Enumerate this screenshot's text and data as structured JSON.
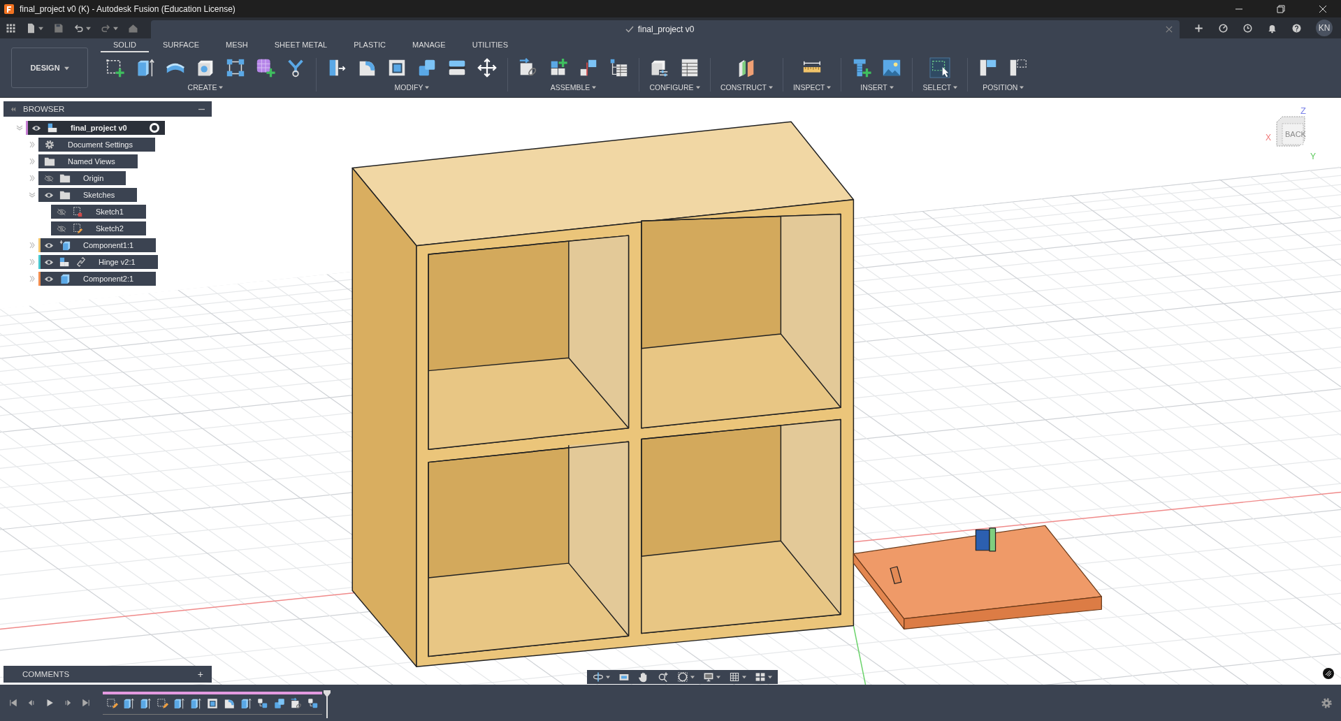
{
  "window": {
    "title": "final_project v0 (K) - Autodesk Fusion (Education License)"
  },
  "app_bar": {
    "left_tools": [
      {
        "kind": "apps",
        "menu": false
      },
      {
        "kind": "file",
        "menu": true
      },
      {
        "kind": "save",
        "menu": false
      },
      {
        "kind": "undo",
        "menu": true
      },
      {
        "kind": "redo",
        "menu": true
      },
      {
        "kind": "home",
        "menu": false
      }
    ],
    "document_tab": {
      "title": "final_project v0",
      "saved": true
    },
    "right_tools": [
      {
        "kind": "plus"
      },
      {
        "kind": "extensions"
      },
      {
        "kind": "jobs"
      },
      {
        "kind": "bell"
      },
      {
        "kind": "help"
      }
    ],
    "avatar": "KN"
  },
  "workspace": "DESIGN",
  "tabs": [
    {
      "label": "SOLID",
      "selected": true
    },
    {
      "label": "SURFACE",
      "selected": false
    },
    {
      "label": "MESH",
      "selected": false
    },
    {
      "label": "SHEET METAL",
      "selected": false
    },
    {
      "label": "PLASTIC",
      "selected": false
    },
    {
      "label": "MANAGE",
      "selected": false
    },
    {
      "label": "UTILITIES",
      "selected": false
    }
  ],
  "toolbar_groups": [
    {
      "label": "CREATE",
      "tools": [
        {
          "kind": "sketch"
        },
        {
          "kind": "extrude"
        },
        {
          "kind": "revolve"
        },
        {
          "kind": "hole"
        },
        {
          "kind": "pattern"
        },
        {
          "kind": "form"
        },
        {
          "kind": "derive"
        }
      ]
    },
    {
      "label": "MODIFY",
      "tools": [
        {
          "kind": "presspull"
        },
        {
          "kind": "fillet"
        },
        {
          "kind": "shell"
        },
        {
          "kind": "combine"
        },
        {
          "kind": "split"
        },
        {
          "kind": "move"
        }
      ]
    },
    {
      "label": "ASSEMBLE",
      "tools": [
        {
          "kind": "joint"
        },
        {
          "kind": "newcomp"
        },
        {
          "kind": "asbuilt"
        },
        {
          "kind": "bom"
        }
      ]
    },
    {
      "label": "CONFIGURE",
      "tools": [
        {
          "kind": "configure"
        },
        {
          "kind": "table"
        }
      ]
    },
    {
      "label": "CONSTRUCT",
      "tools": [
        {
          "kind": "plane"
        }
      ]
    },
    {
      "label": "INSPECT",
      "tools": [
        {
          "kind": "measure"
        }
      ]
    },
    {
      "label": "INSERT",
      "tools": [
        {
          "kind": "bolt"
        },
        {
          "kind": "image"
        }
      ]
    },
    {
      "label": "SELECT",
      "tools": [
        {
          "kind": "select"
        }
      ]
    },
    {
      "label": "POSITION",
      "tools": [
        {
          "kind": "capture"
        },
        {
          "kind": "revert"
        }
      ]
    }
  ],
  "browser": {
    "title": "BROWSER",
    "root": {
      "label": "final_project v0",
      "kind": "assembly",
      "visible": true,
      "color": "#c77fd3",
      "expanded": true,
      "active": true,
      "children": [
        {
          "label": "Document Settings",
          "kind": "gear",
          "expanded": false
        },
        {
          "label": "Named Views",
          "kind": "folder",
          "expanded": false
        },
        {
          "label": "Origin",
          "kind": "folder",
          "visible": false,
          "expanded": false
        },
        {
          "label": "Sketches",
          "kind": "folder",
          "visible": true,
          "expanded": true,
          "children": [
            {
              "label": "Sketch1",
              "kind": "sketch-locked",
              "visible": false
            },
            {
              "label": "Sketch2",
              "kind": "sketch-edit",
              "visible": false
            }
          ]
        },
        {
          "label": "Component1:1",
          "kind": "component-anchored",
          "visible": true,
          "color": "#f2c46a",
          "expanded": false
        },
        {
          "label": "Hinge v2:1",
          "kind": "linked-assembly",
          "visible": true,
          "color": "#45c3cc",
          "expanded": false
        },
        {
          "label": "Component2:1",
          "kind": "component",
          "visible": true,
          "color": "#ef8a4c",
          "expanded": false
        }
      ]
    }
  },
  "view_cube": {
    "face": "BACK",
    "axes": [
      "Z",
      "X",
      "Y"
    ]
  },
  "comments": {
    "title": "COMMENTS",
    "action": "+"
  },
  "nav_bar": [
    {
      "kind": "orbit",
      "menu": true
    },
    {
      "kind": "lookat",
      "menu": false
    },
    {
      "kind": "pan",
      "menu": false
    },
    {
      "kind": "zoom",
      "menu": false
    },
    {
      "kind": "fit",
      "menu": true
    },
    {
      "kind": "display",
      "menu": true
    },
    {
      "kind": "grid",
      "menu": true
    },
    {
      "kind": "viewports",
      "menu": true
    }
  ],
  "timeline": {
    "playback": [
      {
        "kind": "first"
      },
      {
        "kind": "prev"
      },
      {
        "kind": "play"
      },
      {
        "kind": "next"
      },
      {
        "kind": "last"
      }
    ],
    "features": [
      {
        "kind": "sketch-edit"
      },
      {
        "kind": "extrude"
      },
      {
        "kind": "extrude"
      },
      {
        "kind": "sketch-edit"
      },
      {
        "kind": "extrude"
      },
      {
        "kind": "extrude"
      },
      {
        "kind": "shell"
      },
      {
        "kind": "fillet"
      },
      {
        "kind": "extrude"
      },
      {
        "kind": "components"
      },
      {
        "kind": "combine"
      },
      {
        "kind": "joint"
      },
      {
        "kind": "components"
      }
    ]
  }
}
